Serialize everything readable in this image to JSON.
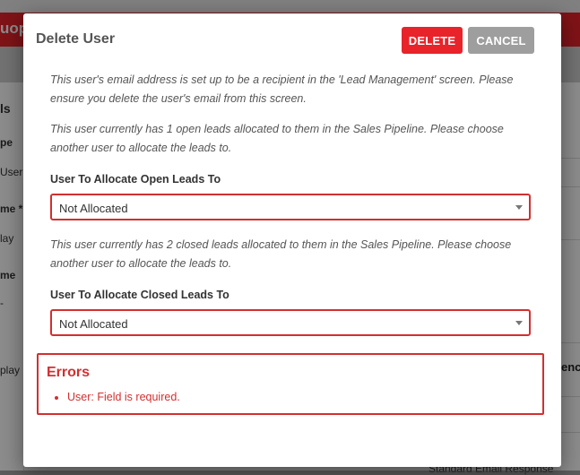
{
  "background": {
    "brand_fragment": "uop",
    "left_labels": [
      "ls",
      "pe",
      "User",
      "me *",
      "lay",
      "me",
      "-",
      "play"
    ],
    "right_fragment": "ence",
    "bottom_fragment": "Standard Email Response"
  },
  "modal": {
    "title": "Delete User",
    "delete_label": "DELETE",
    "cancel_label": "CANCEL",
    "note_email": "This user's email address is set up to be a recipient in the 'Lead Management' screen. Please ensure you delete the user's email from this screen.",
    "note_open": "This user currently has 1 open leads allocated to them in the Sales Pipeline. Please choose another user to allocate the leads to.",
    "open_leads": {
      "label": "User To Allocate Open Leads To",
      "selected": "Not Allocated"
    },
    "note_closed": "This user currently has 2 closed leads allocated to them in the Sales Pipeline. Please choose another user to allocate the leads to.",
    "closed_leads": {
      "label": "User To Allocate Closed Leads To",
      "selected": "Not Allocated"
    },
    "errors": {
      "title": "Errors",
      "items": [
        "User: Field is required."
      ]
    }
  },
  "colors": {
    "accent": "#e8232a",
    "error": "#d32f2f",
    "cancel": "#9e9e9e"
  }
}
